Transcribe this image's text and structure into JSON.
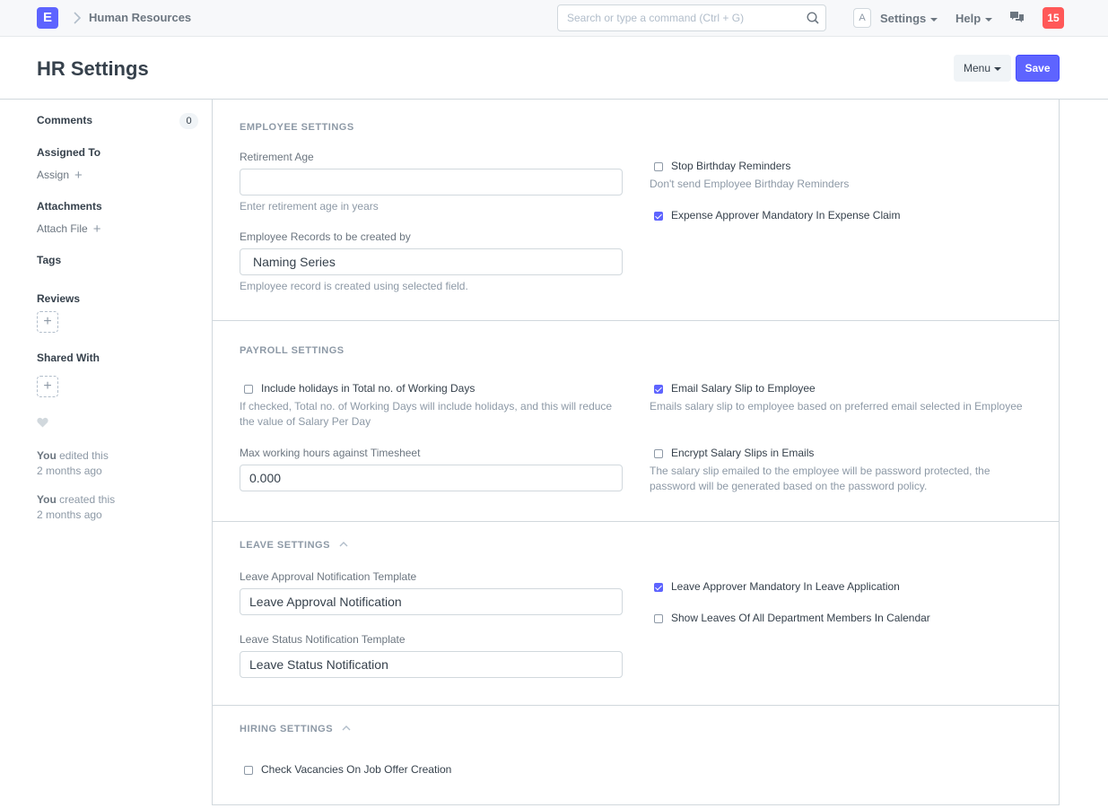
{
  "navbar": {
    "logo_letter": "E",
    "breadcrumb": "Human Resources",
    "search_placeholder": "Search or type a command (Ctrl + G)",
    "avatar_letter": "A",
    "settings_label": "Settings",
    "help_label": "Help",
    "notification_count": "15"
  },
  "page": {
    "title": "HR Settings",
    "menu_label": "Menu",
    "save_label": "Save"
  },
  "sidebar": {
    "comments_label": "Comments",
    "comments_count": "0",
    "assigned_to_label": "Assigned To",
    "assign_link": "Assign",
    "attachments_label": "Attachments",
    "attach_link": "Attach File",
    "tags_label": "Tags",
    "reviews_label": "Reviews",
    "shared_with_label": "Shared With",
    "activity": [
      {
        "who": "You",
        "action": " edited this",
        "when": "2 months ago"
      },
      {
        "who": "You",
        "action": " created this",
        "when": "2 months ago"
      }
    ]
  },
  "employee": {
    "heading": "EMPLOYEE SETTINGS",
    "retirement_age_label": "Retirement Age",
    "retirement_age_value": "",
    "retirement_age_desc": "Enter retirement age in years",
    "records_label": "Employee Records to be created by",
    "records_value": "Naming Series",
    "records_desc": "Employee record is created using selected field.",
    "stop_birthday_label": "Stop Birthday Reminders",
    "stop_birthday_checked": false,
    "stop_birthday_desc": "Don't send Employee Birthday Reminders",
    "expense_approver_label": "Expense Approver Mandatory In Expense Claim",
    "expense_approver_checked": true
  },
  "payroll": {
    "heading": "PAYROLL SETTINGS",
    "include_holidays_label": "Include holidays in Total no. of Working Days",
    "include_holidays_checked": false,
    "include_holidays_desc": "If checked, Total no. of Working Days will include holidays, and this will reduce the value of Salary Per Day",
    "max_hours_label": "Max working hours against Timesheet",
    "max_hours_value": "0.000",
    "email_slip_label": "Email Salary Slip to Employee",
    "email_slip_checked": true,
    "email_slip_desc": "Emails salary slip to employee based on preferred email selected in Employee",
    "encrypt_label": "Encrypt Salary Slips in Emails",
    "encrypt_checked": false,
    "encrypt_desc": "The salary slip emailed to the employee will be password protected, the password will be generated based on the password policy."
  },
  "leave": {
    "heading": "LEAVE SETTINGS",
    "approval_template_label": "Leave Approval Notification Template",
    "approval_template_value": "Leave Approval Notification",
    "status_template_label": "Leave Status Notification Template",
    "status_template_value": "Leave Status Notification",
    "approver_mandatory_label": "Leave Approver Mandatory In Leave Application",
    "approver_mandatory_checked": true,
    "show_leaves_label": "Show Leaves Of All Department Members In Calendar",
    "show_leaves_checked": false
  },
  "hiring": {
    "heading": "HIRING SETTINGS",
    "check_vacancies_label": "Check Vacancies On Job Offer Creation",
    "check_vacancies_checked": false
  },
  "colors": {
    "primary": "#5e64ff",
    "notification": "#ff5858",
    "text": "#36414c",
    "muted": "#8d99a6"
  }
}
